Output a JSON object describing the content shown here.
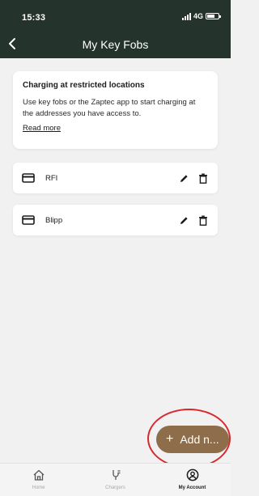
{
  "status_bar": {
    "time": "15:33",
    "network": "4G"
  },
  "header": {
    "title": "My Key Fobs",
    "back_icon": "chevron-left-icon"
  },
  "info_card": {
    "title": "Charging at restricted locations",
    "body": "Use key fobs or the Zaptec app to start charging at the addresses you have access to.",
    "link_label": "Read more"
  },
  "key_fobs": [
    {
      "name": "RFI",
      "icon": "card-icon",
      "edit_icon": "pencil-icon",
      "delete_icon": "trash-icon"
    },
    {
      "name": "Blipp",
      "icon": "card-icon",
      "edit_icon": "pencil-icon",
      "delete_icon": "trash-icon"
    }
  ],
  "add_button": {
    "icon": "+",
    "label": "Add n..."
  },
  "bottom_nav": [
    {
      "label": "Home",
      "icon": "home-icon",
      "active": false
    },
    {
      "label": "Chargers",
      "icon": "plug-icon",
      "active": false
    },
    {
      "label": "My Account",
      "icon": "account-icon",
      "active": true
    }
  ],
  "colors": {
    "header_bg": "#24332b",
    "fab_bg": "#8e6d4a",
    "highlight_ring": "#d8282e",
    "page_bg": "#f1f1f1"
  }
}
